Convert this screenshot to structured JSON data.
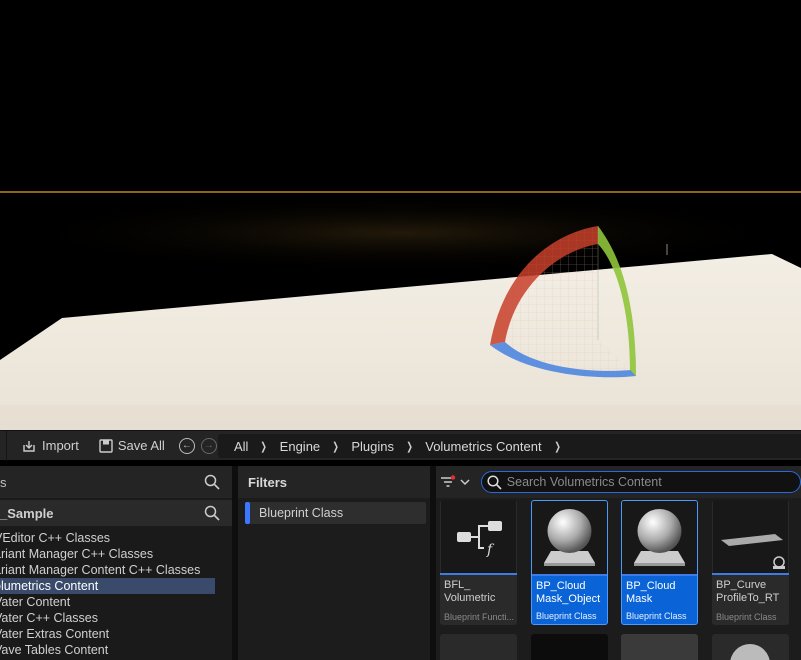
{
  "toolbar": {
    "import_label": "Import",
    "save_all_label": "Save All"
  },
  "breadcrumb": [
    "All",
    "Engine",
    "Plugins",
    "Volumetrics Content"
  ],
  "left_panel": {
    "header_label": "s",
    "project_label": "_Sample",
    "tree": [
      {
        "label": "VEditor C++ Classes",
        "selected": false
      },
      {
        "label": "ariant Manager C++ Classes",
        "selected": false
      },
      {
        "label": "ariant Manager Content C++ Classes",
        "selected": false
      },
      {
        "label": "olumetrics Content",
        "selected": true
      },
      {
        "label": "Vater Content",
        "selected": false
      },
      {
        "label": "Vater C++ Classes",
        "selected": false
      },
      {
        "label": "Vater Extras Content",
        "selected": false
      },
      {
        "label": "Vave Tables Content",
        "selected": false
      }
    ]
  },
  "filters": {
    "title": "Filters",
    "items": [
      {
        "label": "Blueprint Class",
        "color": "#3c78ff"
      }
    ]
  },
  "assets": {
    "search_placeholder": "Search Volumetrics Content",
    "tiles": [
      {
        "name": "BFL_ Volumetric",
        "type": "Blueprint Functi...",
        "selected": false,
        "thumb": "function-library-icon"
      },
      {
        "name": "BP_Cloud Mask_Object",
        "type": "Blueprint Class",
        "selected": true,
        "thumb": "sphere-icon"
      },
      {
        "name": "BP_Cloud Mask",
        "type": "Blueprint Class",
        "selected": true,
        "thumb": "sphere-icon"
      },
      {
        "name": "BP_Curve ProfileTo_RT",
        "type": "Blueprint Class",
        "selected": false,
        "thumb": "plane-icon"
      }
    ]
  },
  "colors": {
    "accent": "#0a64d8",
    "panel_bg": "#1c1c1c",
    "selection_bg": "#3a4a6a"
  }
}
